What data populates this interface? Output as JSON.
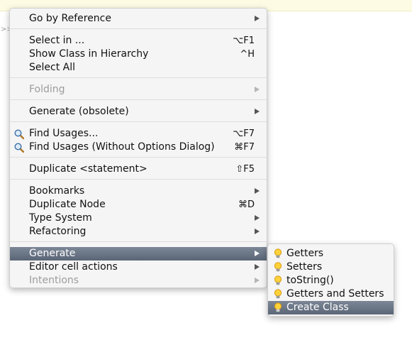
{
  "context_menu": {
    "items": [
      {
        "label": "Go by Reference",
        "shortcut": "",
        "has_submenu": true,
        "disabled": false
      },
      {
        "label": "Select in ...",
        "shortcut": "⌥F1",
        "has_submenu": false,
        "disabled": false
      },
      {
        "label": "Show Class in Hierarchy",
        "shortcut": "^H",
        "has_submenu": false,
        "disabled": false
      },
      {
        "label": "Select All",
        "shortcut": "",
        "has_submenu": false,
        "disabled": false
      },
      {
        "label": "Folding",
        "shortcut": "",
        "has_submenu": true,
        "disabled": true
      },
      {
        "label": "Generate (obsolete)",
        "shortcut": "",
        "has_submenu": true,
        "disabled": false
      },
      {
        "label": "Find Usages...",
        "shortcut": "⌥F7",
        "has_submenu": false,
        "disabled": false,
        "icon": "magnifier-icon"
      },
      {
        "label": "Find Usages (Without Options Dialog)",
        "shortcut": "⌘F7",
        "has_submenu": false,
        "disabled": false,
        "icon": "magnifier-icon"
      },
      {
        "label": "Duplicate <statement>",
        "shortcut": "⇧F5",
        "has_submenu": false,
        "disabled": false
      },
      {
        "label": "Bookmarks",
        "shortcut": "",
        "has_submenu": true,
        "disabled": false
      },
      {
        "label": "Duplicate Node",
        "shortcut": "⌘D",
        "has_submenu": false,
        "disabled": false
      },
      {
        "label": "Type System",
        "shortcut": "",
        "has_submenu": true,
        "disabled": false
      },
      {
        "label": "Refactoring",
        "shortcut": "",
        "has_submenu": true,
        "disabled": false
      },
      {
        "label": "Generate",
        "shortcut": "",
        "has_submenu": true,
        "disabled": false,
        "highlighted": true
      },
      {
        "label": "Editor cell actions",
        "shortcut": "",
        "has_submenu": true,
        "disabled": false
      },
      {
        "label": "Intentions",
        "shortcut": "",
        "has_submenu": true,
        "disabled": true
      }
    ]
  },
  "generate_submenu": {
    "items": [
      {
        "label": "Getters",
        "icon": "lightbulb-icon"
      },
      {
        "label": "Setters",
        "icon": "lightbulb-icon"
      },
      {
        "label": "toString()",
        "icon": "lightbulb-icon"
      },
      {
        "label": "Getters and Setters",
        "icon": "lightbulb-icon"
      },
      {
        "label": "Create Class",
        "icon": "lightbulb-icon",
        "highlighted": true
      }
    ]
  },
  "editor": {
    "gutter_marker": ">>"
  },
  "colors": {
    "menu_background": "#f5f5f5",
    "highlight": "#636e80",
    "disabled_text": "#9c9c9c",
    "editor_strip": "#fdfbe3"
  }
}
